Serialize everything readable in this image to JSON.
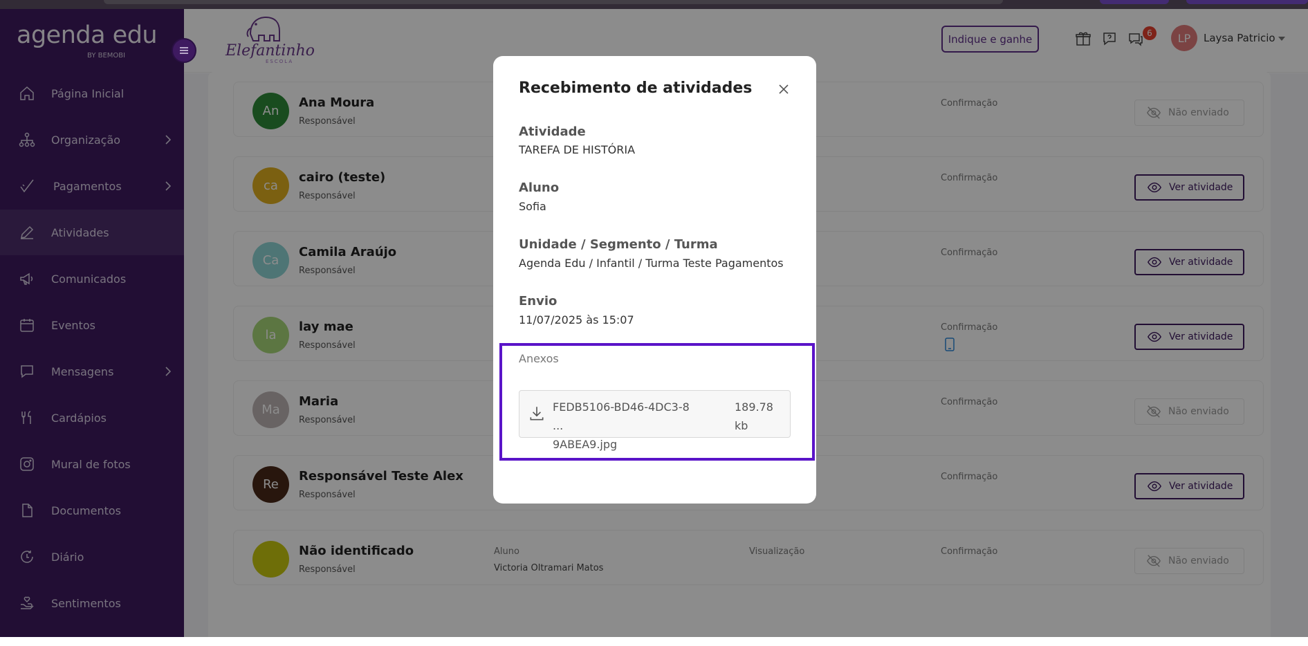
{
  "app": {
    "logo_text_a": "agenda",
    "logo_text_b": " edu",
    "logo_sub": "BY BEMOBI"
  },
  "sidebar": {
    "items": [
      {
        "label": "Página Inicial",
        "icon": "home-icon",
        "chevron": false,
        "active": false
      },
      {
        "label": "Organização",
        "icon": "org-chart-icon",
        "chevron": true,
        "active": false
      },
      {
        "label": "Pagamentos",
        "icon": "check-pen-icon",
        "chevron": true,
        "active": false
      },
      {
        "label": "Atividades",
        "icon": "pencil-icon",
        "chevron": false,
        "active": true
      },
      {
        "label": "Comunicados",
        "icon": "megaphone-icon",
        "chevron": false,
        "active": false
      },
      {
        "label": "Eventos",
        "icon": "calendar-icon",
        "chevron": false,
        "active": false
      },
      {
        "label": "Mensagens",
        "icon": "chat-icon",
        "chevron": true,
        "active": false
      },
      {
        "label": "Cardápios",
        "icon": "cutlery-icon",
        "chevron": false,
        "active": false
      },
      {
        "label": "Mural de fotos",
        "icon": "camera-icon",
        "chevron": false,
        "active": false
      },
      {
        "label": "Documentos",
        "icon": "document-icon",
        "chevron": false,
        "active": false
      },
      {
        "label": "Diário",
        "icon": "diary-icon",
        "chevron": false,
        "active": false
      },
      {
        "label": "Sentimentos",
        "icon": "heart-hand-icon",
        "chevron": false,
        "active": false
      }
    ]
  },
  "header": {
    "school_name": "Elefantinho",
    "school_sub": "ESCOLA",
    "indique_label": "Indique e ganhe",
    "message_badge": "6",
    "user_initials": "LP",
    "user_name": "Laysa Patricio"
  },
  "rows": [
    {
      "initials": "An",
      "color": "#2e8b3a",
      "name": "Ana Moura",
      "role": "Responsável",
      "confirm": "Confirmação",
      "status": "Não enviado"
    },
    {
      "initials": "ca",
      "color": "#e0b020",
      "name": "cairo (teste)",
      "role": "Responsável",
      "confirm": "Confirmação",
      "status": "Ver atividade"
    },
    {
      "initials": "Ca",
      "color": "#8fd6d6",
      "name": "Camila Araújo",
      "role": "Responsável",
      "confirm": "Confirmação",
      "status": "Ver atividade"
    },
    {
      "initials": "la",
      "color": "#a8d878",
      "name": "lay mae",
      "role": "Responsável",
      "confirm": "Confirmação",
      "status": "Ver atividade"
    },
    {
      "initials": "Ma",
      "color": "#bdb4b4",
      "name": "Maria",
      "role": "Responsável",
      "confirm": "Confirmação",
      "status": "Não enviado"
    },
    {
      "initials": "Re",
      "color": "#4a2818",
      "name": "Responsável Teste Alex",
      "role": "Responsável",
      "confirm": "Confirmação",
      "status": "Ver atividade"
    },
    {
      "initials": "",
      "color": "#c8c810",
      "name": "Não identificado",
      "role": "Responsável",
      "confirm": "Confirmação",
      "status": "Não enviado"
    }
  ],
  "last_row_extra": {
    "aluno_label": "Aluno",
    "aluno_value": "Victoria Oltramari Matos",
    "visualizacao": "Visualização"
  },
  "modal": {
    "title": "Recebimento de atividades",
    "atividade_label": "Atividade",
    "atividade_value": "TAREFA DE HISTÓRIA",
    "aluno_label": "Aluno",
    "aluno_value": "Sofia",
    "unidade_label": "Unidade / Segmento / Turma",
    "unidade_value": "Agenda Edu / Infantil / Turma Teste Pagamentos",
    "envio_label": "Envio",
    "envio_value": "11/07/2025 às 15:07",
    "anexos_label": "Anexos",
    "file_name_1": "FEDB5106-BD46-4DC3-8 ...",
    "file_name_2": "9ABEA9.jpg",
    "file_size_1": "189.78",
    "file_size_2": "kb"
  },
  "colors": {
    "sidebar_bg": "#3e1a60",
    "accent": "#5d2e88",
    "highlight_border": "#5a14c8",
    "badge": "#e5402f"
  }
}
